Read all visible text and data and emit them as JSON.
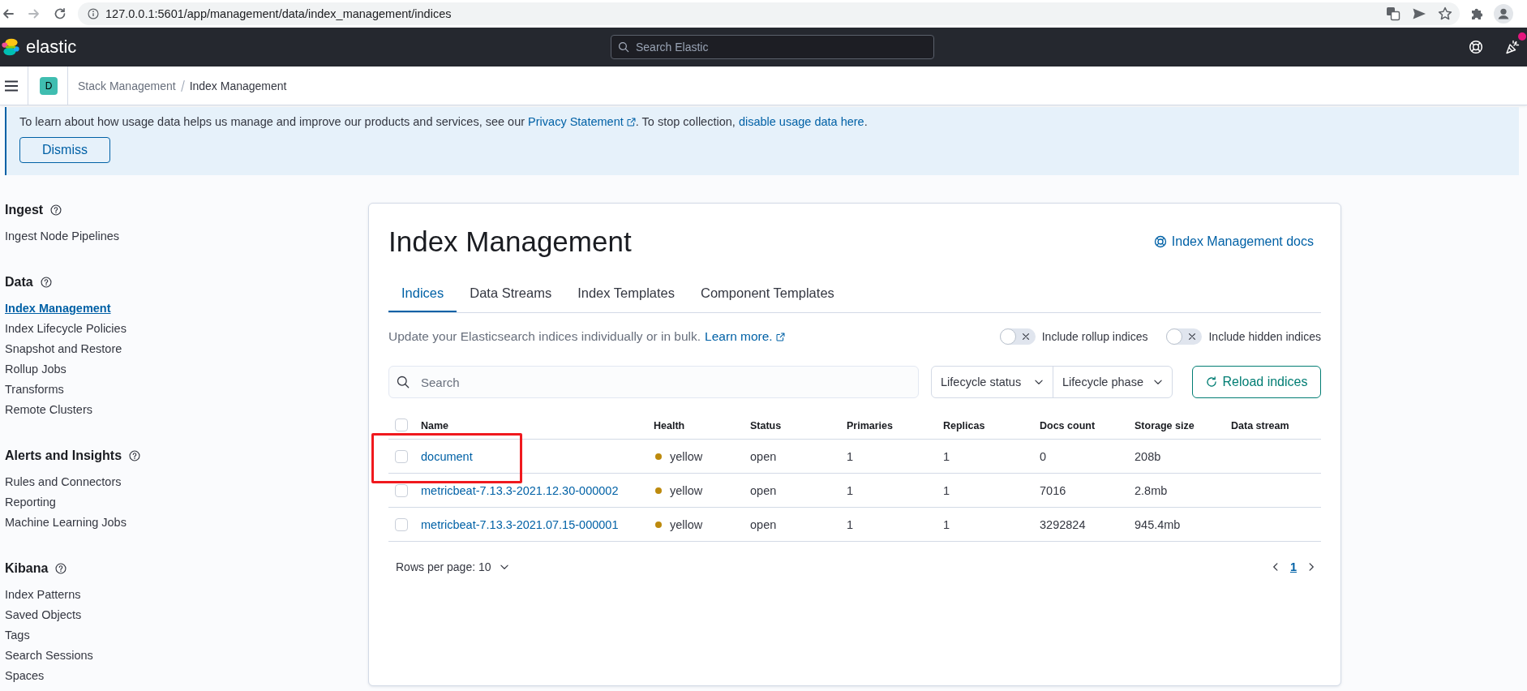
{
  "browser": {
    "url": "127.0.0.1:5601/app/management/data/index_management/indices",
    "forward_disabled": true
  },
  "header": {
    "logo_text": "elastic",
    "search": {
      "placeholder": "Search Elastic"
    },
    "notification": true
  },
  "space": {
    "initial": "D"
  },
  "breadcrumbs": [
    {
      "label": "Stack Management",
      "selected": false
    },
    {
      "label": "Index Management",
      "selected": true
    }
  ],
  "banner": {
    "message": [
      {
        "kind": "text",
        "text": "To learn about how usage data helps us manage and improve our products and services, see our "
      },
      {
        "kind": "link",
        "text": "Privacy Statement",
        "external": true
      },
      {
        "kind": "text",
        "text": ". To stop collection, "
      },
      {
        "kind": "link",
        "text": "disable usage data here",
        "external": false
      },
      {
        "kind": "text",
        "text": "."
      }
    ],
    "button": "Dismiss"
  },
  "sidebar": {
    "sections": [
      {
        "title": "Ingest",
        "items": [
          {
            "label": "Ingest Node Pipelines",
            "selected": false
          }
        ]
      },
      {
        "title": "Data",
        "items": [
          {
            "label": "Index Management",
            "selected": true
          },
          {
            "label": "Index Lifecycle Policies",
            "selected": false
          },
          {
            "label": "Snapshot and Restore",
            "selected": false
          },
          {
            "label": "Rollup Jobs",
            "selected": false
          },
          {
            "label": "Transforms",
            "selected": false
          },
          {
            "label": "Remote Clusters",
            "selected": false
          }
        ]
      },
      {
        "title": "Alerts and Insights",
        "items": [
          {
            "label": "Rules and Connectors",
            "selected": false
          },
          {
            "label": "Reporting",
            "selected": false
          },
          {
            "label": "Machine Learning Jobs",
            "selected": false
          }
        ]
      },
      {
        "title": "Kibana",
        "items": [
          {
            "label": "Index Patterns",
            "selected": false
          },
          {
            "label": "Saved Objects",
            "selected": false
          },
          {
            "label": "Tags",
            "selected": false
          },
          {
            "label": "Search Sessions",
            "selected": false
          },
          {
            "label": "Spaces",
            "selected": false
          }
        ]
      }
    ]
  },
  "card": {
    "title": "Index Management",
    "docs_link": "Index Management docs",
    "tabs": [
      {
        "label": "Indices",
        "selected": true
      },
      {
        "label": "Data Streams",
        "selected": false
      },
      {
        "label": "Index Templates",
        "selected": false
      },
      {
        "label": "Component Templates",
        "selected": false
      }
    ],
    "description": [
      {
        "kind": "text",
        "text": "Update your Elasticsearch indices individually or in bulk."
      },
      {
        "kind": "link",
        "text": "Learn more.",
        "external": true
      }
    ],
    "toggles": [
      {
        "label": "Include rollup indices",
        "on": false
      },
      {
        "label": "Include hidden indices",
        "on": false
      }
    ],
    "search": {
      "placeholder": "Search"
    },
    "filters": [
      "Lifecycle status",
      "Lifecycle phase"
    ],
    "reload_button": "Reload indices",
    "table": {
      "select_all": {
        "checked": false
      },
      "columns": [
        "Name",
        "Health",
        "Status",
        "Primaries",
        "Replicas",
        "Docs count",
        "Storage size",
        "Data stream"
      ],
      "rows": [
        {
          "checked": false,
          "highlighted": true,
          "name": "document",
          "health": "yellow",
          "color": "#bd8a0d",
          "status": "open",
          "primaries": "1",
          "replicas": "1",
          "docs_count": "0",
          "storage_size": "208b"
        },
        {
          "checked": false,
          "highlighted": false,
          "name": "metricbeat-7.13.3-2021.12.30-000002",
          "health": "yellow",
          "color": "#bd8a0d",
          "status": "open",
          "primaries": "1",
          "replicas": "1",
          "docs_count": "7016",
          "storage_size": "2.8mb"
        },
        {
          "checked": false,
          "highlighted": false,
          "name": "metricbeat-7.13.3-2021.07.15-000001",
          "health": "yellow",
          "color": "#bd8a0d",
          "status": "open",
          "primaries": "1",
          "replicas": "1",
          "docs_count": "3292824",
          "storage_size": "945.4mb"
        }
      ]
    },
    "pagination": {
      "rows_per_page": "Rows per page: 10",
      "pages": [
        {
          "label": "1",
          "selected": true
        }
      ]
    }
  }
}
